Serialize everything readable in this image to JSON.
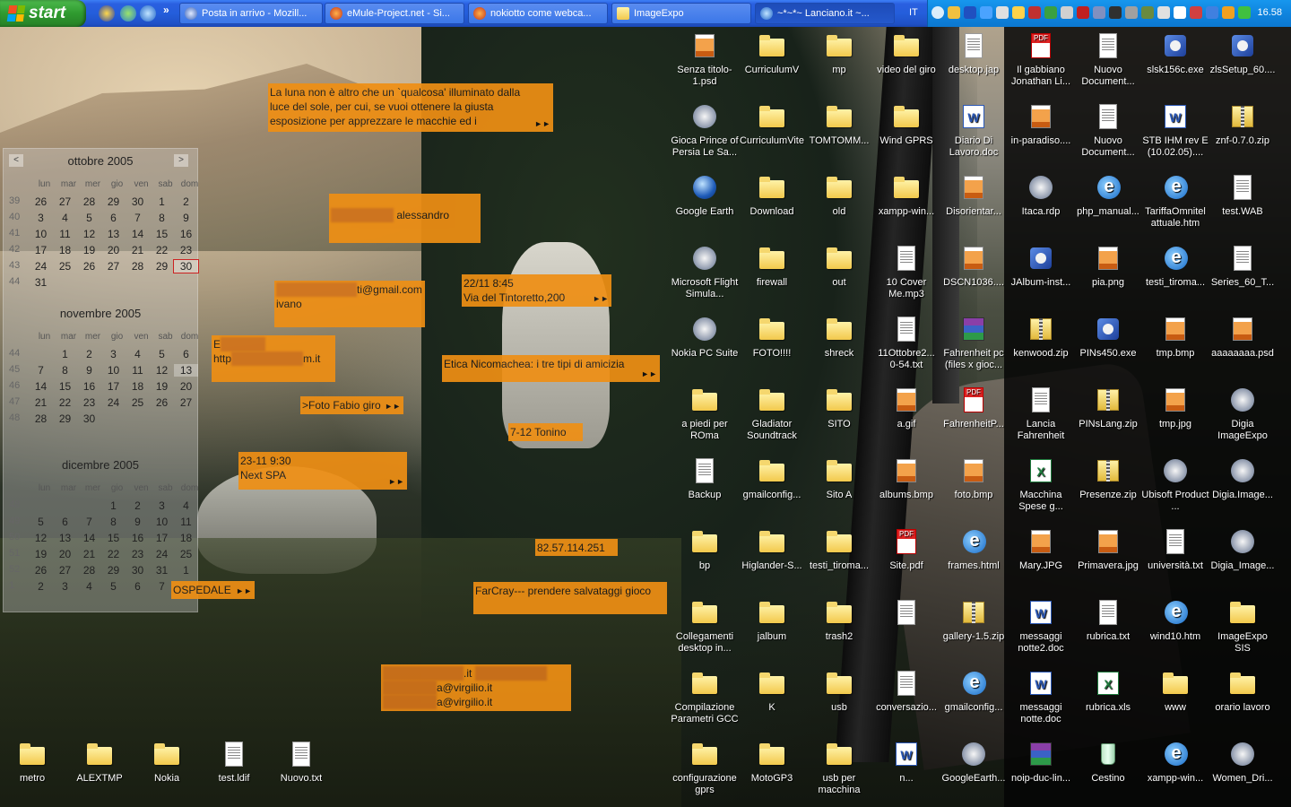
{
  "taskbar": {
    "start_label": "start",
    "tasks": [
      {
        "label": "Posta in arrivo - Mozill...",
        "icon": "thunderbird-icon",
        "active": false
      },
      {
        "label": "eMule-Project.net - Si...",
        "icon": "firefox-icon",
        "active": false
      },
      {
        "label": "nokiotto come webca...",
        "icon": "firefox-icon",
        "active": false
      },
      {
        "label": "ImageExpo",
        "icon": "folder-icon",
        "active": false
      },
      {
        "label": "~*~*~ Lanciano.it ~...",
        "icon": "ie-icon",
        "active": true
      }
    ],
    "language": "IT",
    "clock": "16.58"
  },
  "calendar": {
    "months": [
      {
        "title": "ottobre 2005",
        "weekdays": [
          "lun",
          "mar",
          "mer",
          "gio",
          "ven",
          "sab",
          "dom"
        ],
        "weeks": [
          {
            "num": "39",
            "days": [
              "26",
              "27",
              "28",
              "29",
              "30",
              "1",
              "2"
            ]
          },
          {
            "num": "40",
            "days": [
              "3",
              "4",
              "5",
              "6",
              "7",
              "8",
              "9"
            ]
          },
          {
            "num": "41",
            "days": [
              "10",
              "11",
              "12",
              "13",
              "14",
              "15",
              "16"
            ]
          },
          {
            "num": "42",
            "days": [
              "17",
              "18",
              "19",
              "20",
              "21",
              "22",
              "23"
            ]
          },
          {
            "num": "43",
            "days": [
              "24",
              "25",
              "26",
              "27",
              "28",
              "29",
              "30"
            ]
          },
          {
            "num": "44",
            "days": [
              "31",
              "",
              "",
              "",
              "",
              "",
              ""
            ]
          }
        ]
      },
      {
        "title": "novembre 2005",
        "weekdays": [
          "lun",
          "mar",
          "mer",
          "gio",
          "ven",
          "sab",
          "dom"
        ],
        "weeks": [
          {
            "num": "44",
            "days": [
              "",
              "1",
              "2",
              "3",
              "4",
              "5",
              "6"
            ]
          },
          {
            "num": "45",
            "days": [
              "7",
              "8",
              "9",
              "10",
              "11",
              "12",
              "13"
            ]
          },
          {
            "num": "46",
            "days": [
              "14",
              "15",
              "16",
              "17",
              "18",
              "19",
              "20"
            ]
          },
          {
            "num": "47",
            "days": [
              "21",
              "22",
              "23",
              "24",
              "25",
              "26",
              "27"
            ]
          },
          {
            "num": "48",
            "days": [
              "28",
              "29",
              "30",
              "",
              "",
              "",
              ""
            ]
          }
        ]
      },
      {
        "title": "dicembre 2005",
        "weekdays": [
          "lun",
          "mar",
          "mer",
          "gio",
          "ven",
          "sab",
          "dom"
        ],
        "weeks": [
          {
            "num": "48",
            "days": [
              "",
              "",
              "",
              "1",
              "2",
              "3",
              "4"
            ]
          },
          {
            "num": "49",
            "days": [
              "5",
              "6",
              "7",
              "8",
              "9",
              "10",
              "11"
            ]
          },
          {
            "num": "50",
            "days": [
              "12",
              "13",
              "14",
              "15",
              "16",
              "17",
              "18"
            ]
          },
          {
            "num": "51",
            "days": [
              "19",
              "20",
              "21",
              "22",
              "23",
              "24",
              "25"
            ]
          },
          {
            "num": "52",
            "days": [
              "26",
              "27",
              "28",
              "29",
              "30",
              "31",
              "1"
            ]
          },
          {
            "num": "1",
            "days": [
              "2",
              "3",
              "4",
              "5",
              "6",
              "7",
              ""
            ]
          }
        ]
      }
    ],
    "nav_prev": "<",
    "nav_next": ">"
  },
  "notes": [
    {
      "id": "luna",
      "lines": [
        "La luna non è altro che un `qualcosa' illuminato dalla",
        "luce del sole, per cui, se vuoi ottenere la giusta",
        "esposizione per apprezzare le macchie ed i"
      ]
    },
    {
      "id": "alessandro",
      "lines": [
        "alessandro"
      ]
    },
    {
      "id": "gmail",
      "lines": [
        "ti@gmail.com",
        "ivano"
      ]
    },
    {
      "id": "tintoretto",
      "lines": [
        "22/11 8:45",
        "Via del Tintoretto,200"
      ]
    },
    {
      "id": "http",
      "lines": [
        "E",
        "http",
        "m.it"
      ]
    },
    {
      "id": "etica",
      "lines": [
        "Etica Nicomachea: i tre tipi di amicizia"
      ]
    },
    {
      "id": "fabio",
      "lines": [
        ">Foto Fabio giro"
      ]
    },
    {
      "id": "tonino",
      "lines": [
        "7-12 Tonino"
      ]
    },
    {
      "id": "spa",
      "lines": [
        "23-11 9:30",
        "Next  SPA"
      ]
    },
    {
      "id": "ip",
      "lines": [
        "82.57.114.251"
      ]
    },
    {
      "id": "ospedale",
      "lines": [
        "OSPEDALE"
      ]
    },
    {
      "id": "farcray",
      "lines": [
        "FarCray--- prendere salvataggi gioco"
      ]
    },
    {
      "id": "virgilio",
      "lines": [
        ".it",
        "a@virgilio.it",
        "a@virgilio.it"
      ]
    }
  ],
  "icons": [
    {
      "label": "Senza titolo-1.psd",
      "type": "img"
    },
    {
      "label": "CurriculumV",
      "type": "folder"
    },
    {
      "label": "mp",
      "type": "folder"
    },
    {
      "label": "video del giro",
      "type": "folder"
    },
    {
      "label": "desktop.jap",
      "type": "doc"
    },
    {
      "label": "Il gabbiano Jonathan Li...",
      "type": "pdf"
    },
    {
      "label": "Nuovo Document...",
      "type": "doc"
    },
    {
      "label": "slsk156c.exe",
      "type": "exe"
    },
    {
      "label": "zlsSetup_60....",
      "type": "exe"
    },
    {
      "label": "Gioca Prince of Persia Le Sa...",
      "type": "app"
    },
    {
      "label": "CurriculumVite",
      "type": "folder"
    },
    {
      "label": "TOMTOMM...",
      "type": "folder"
    },
    {
      "label": "Wind GPRS",
      "type": "folder"
    },
    {
      "label": "Diario Di Lavoro.doc",
      "type": "word"
    },
    {
      "label": "in-paradiso....",
      "type": "img"
    },
    {
      "label": "Nuovo Document...",
      "type": "doc"
    },
    {
      "label": "STB IHM rev E (10.02.05)....",
      "type": "word"
    },
    {
      "label": "znf-0.7.0.zip",
      "type": "zip"
    },
    {
      "label": "Google Earth",
      "type": "earth"
    },
    {
      "label": "Download",
      "type": "folder"
    },
    {
      "label": "old",
      "type": "folder"
    },
    {
      "label": "xampp-win...",
      "type": "folder"
    },
    {
      "label": "Disorientar...",
      "type": "img"
    },
    {
      "label": "Itaca.rdp",
      "type": "app"
    },
    {
      "label": "php_manual...",
      "type": "ie"
    },
    {
      "label": "TariffaOmnitel attuale.htm",
      "type": "ie"
    },
    {
      "label": "test.WAB",
      "type": "doc"
    },
    {
      "label": "Microsoft Flight Simula...",
      "type": "app"
    },
    {
      "label": "firewall",
      "type": "folder"
    },
    {
      "label": "out",
      "type": "folder"
    },
    {
      "label": "10 Cover Me.mp3",
      "type": "doc"
    },
    {
      "label": "DSCN1036....",
      "type": "img"
    },
    {
      "label": "JAlbum-inst...",
      "type": "exe"
    },
    {
      "label": "pia.png",
      "type": "img"
    },
    {
      "label": "testi_tiroma...",
      "type": "ie"
    },
    {
      "label": "Series_60_T...",
      "type": "doc"
    },
    {
      "label": "Nokia PC Suite",
      "type": "app"
    },
    {
      "label": "FOTO!!!!",
      "type": "folder"
    },
    {
      "label": "shreck",
      "type": "folder"
    },
    {
      "label": "11Ottobre2... 0-54.txt",
      "type": "doc"
    },
    {
      "label": "Fahrenheit pc (files x gioc...",
      "type": "rar"
    },
    {
      "label": "kenwood.zip",
      "type": "zip"
    },
    {
      "label": "PINs450.exe",
      "type": "exe"
    },
    {
      "label": "tmp.bmp",
      "type": "img"
    },
    {
      "label": "aaaaaaaa.psd",
      "type": "img"
    },
    {
      "label": "a piedi per ROma",
      "type": "folder"
    },
    {
      "label": "Gladiator Soundtrack",
      "type": "folder"
    },
    {
      "label": "SITO",
      "type": "folder"
    },
    {
      "label": "a.gif",
      "type": "img"
    },
    {
      "label": "FahrenheitP...",
      "type": "pdf"
    },
    {
      "label": "Lancia Fahrenheit",
      "type": "doc"
    },
    {
      "label": "PINsLang.zip",
      "type": "zip"
    },
    {
      "label": "tmp.jpg",
      "type": "img"
    },
    {
      "label": "Digia ImageExpo",
      "type": "app"
    },
    {
      "label": "Backup",
      "type": "doc"
    },
    {
      "label": "gmailconfig...",
      "type": "folder"
    },
    {
      "label": "Sito A",
      "type": "folder"
    },
    {
      "label": "albums.bmp",
      "type": "img"
    },
    {
      "label": "foto.bmp",
      "type": "img"
    },
    {
      "label": "Macchina Spese g...",
      "type": "xls"
    },
    {
      "label": "Presenze.zip",
      "type": "zip"
    },
    {
      "label": "Ubisoft Product ...",
      "type": "app"
    },
    {
      "label": "Digia.Image...",
      "type": "app"
    },
    {
      "label": "bp",
      "type": "folder"
    },
    {
      "label": "Higlander-S...",
      "type": "folder"
    },
    {
      "label": "testi_tiroma...",
      "type": "folder"
    },
    {
      "label": "Site.pdf",
      "type": "pdf"
    },
    {
      "label": "frames.html",
      "type": "ie"
    },
    {
      "label": "Mary.JPG",
      "type": "img"
    },
    {
      "label": "Primavera.jpg",
      "type": "img"
    },
    {
      "label": "università.txt",
      "type": "doc"
    },
    {
      "label": "Digia_Image...",
      "type": "app"
    },
    {
      "label": "Collegamenti desktop in...",
      "type": "folder"
    },
    {
      "label": "jalbum",
      "type": "folder"
    },
    {
      "label": "trash2",
      "type": "folder"
    },
    {
      "label": "",
      "type": "doc"
    },
    {
      "label": "gallery-1.5.zip",
      "type": "zip"
    },
    {
      "label": "messaggi notte2.doc",
      "type": "word"
    },
    {
      "label": "rubrica.txt",
      "type": "doc"
    },
    {
      "label": "wind10.htm",
      "type": "ie"
    },
    {
      "label": "ImageExpo SIS",
      "type": "folder"
    },
    {
      "label": "Compilazione Parametri GCC",
      "type": "folder"
    },
    {
      "label": "K",
      "type": "folder"
    },
    {
      "label": "usb",
      "type": "folder"
    },
    {
      "label": "conversazio...",
      "type": "doc"
    },
    {
      "label": "gmailconfig...",
      "type": "ie"
    },
    {
      "label": "messaggi notte.doc",
      "type": "word"
    },
    {
      "label": "rubrica.xls",
      "type": "xls"
    },
    {
      "label": "www",
      "type": "folder"
    },
    {
      "label": "orario lavoro",
      "type": "folder"
    },
    {
      "label": "configurazione gprs",
      "type": "folder"
    },
    {
      "label": "MotoGP3",
      "type": "folder"
    },
    {
      "label": "usb per macchina",
      "type": "folder"
    },
    {
      "label": "n...",
      "type": "word"
    },
    {
      "label": "GoogleEarth...",
      "type": "app"
    },
    {
      "label": "noip-duc-lin...",
      "type": "rar"
    },
    {
      "label": "Cestino",
      "type": "bin"
    },
    {
      "label": "xampp-win...",
      "type": "ie"
    },
    {
      "label": "Women_Dri...",
      "type": "app"
    }
  ],
  "bottom_icons": [
    {
      "label": "metro",
      "type": "folder"
    },
    {
      "label": "ALEXTMP",
      "type": "folder"
    },
    {
      "label": "Nokia",
      "type": "folder"
    },
    {
      "label": "test.ldif",
      "type": "doc"
    },
    {
      "label": "Nuovo.txt",
      "type": "doc"
    }
  ]
}
